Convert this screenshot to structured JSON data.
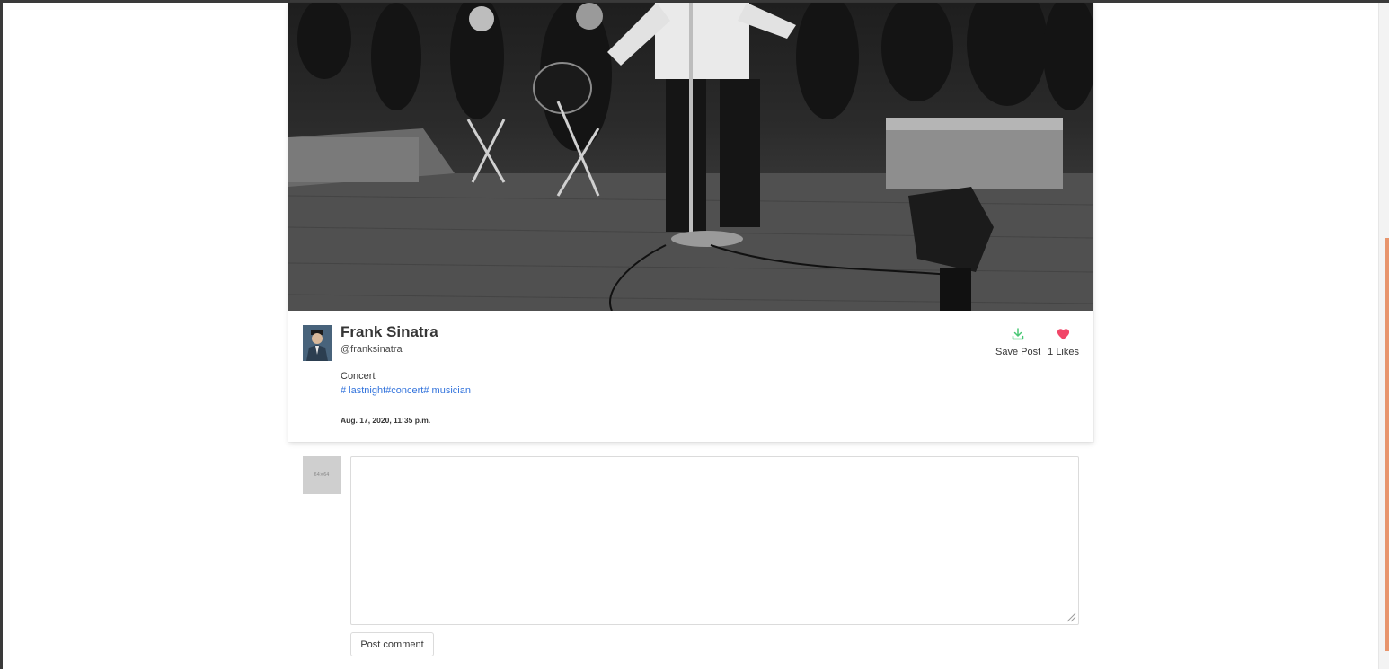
{
  "post": {
    "author_name": "Frank Sinatra",
    "author_handle": "@franksinatra",
    "caption": "Concert",
    "tags": [
      "# lastnight",
      "#concert",
      "# musician"
    ],
    "timestamp": "Aug. 17, 2020, 11:35 p.m.",
    "save_label": "Save Post",
    "likes_label": "1 Likes",
    "save_icon_color": "#48c774",
    "like_icon_color": "#f14668"
  },
  "comment": {
    "avatar_placeholder": "64×64",
    "value": "",
    "button_label": "Post comment"
  },
  "colors": {
    "tag_link": "#3273dc",
    "scrollbar_thumb": "#e8956d"
  },
  "icons": [
    "download-icon",
    "heart-icon",
    "resize-handle-icon"
  ]
}
